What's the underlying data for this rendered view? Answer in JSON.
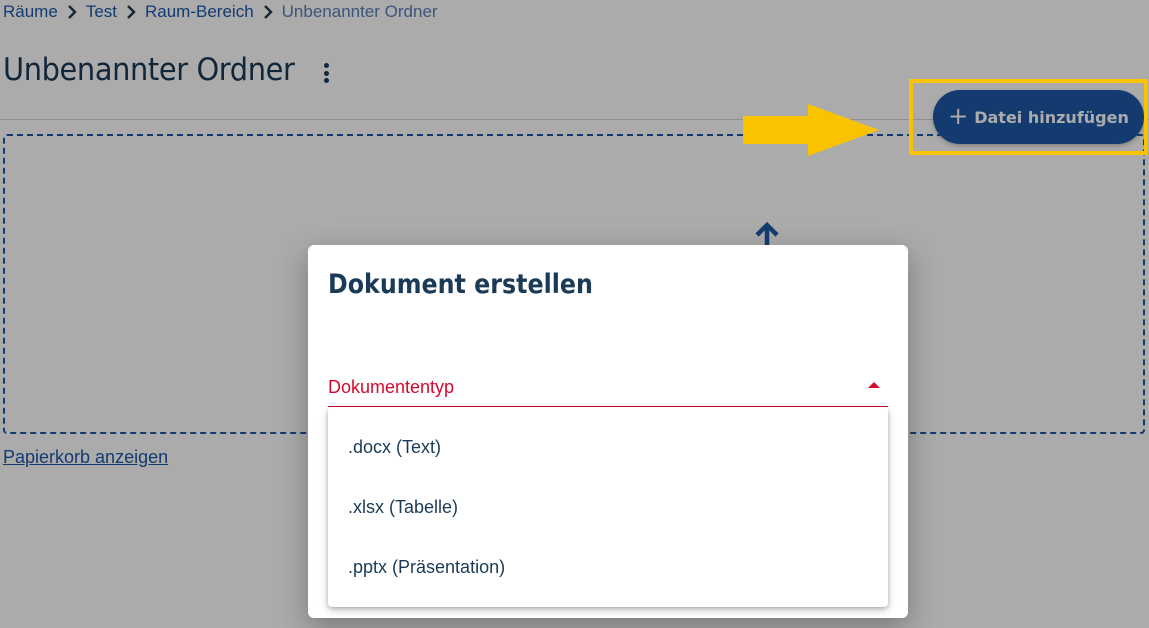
{
  "breadcrumb": {
    "items": [
      "Räume",
      "Test",
      "Raum-Bereich",
      "Unbenannter Ordner"
    ]
  },
  "page": {
    "title": "Unbenannter Ordner"
  },
  "toolbar": {
    "add_file_label": "Datei hinzufügen",
    "add_file_icon": "plus-icon"
  },
  "dropzone": {
    "icon": "upload-arrow-icon"
  },
  "trash_link": "Papierkorb anzeigen",
  "annotation": {
    "highlight_color": "#f9c300",
    "arrow_color": "#f9c300"
  },
  "dialog": {
    "title": "Dokument erstellen",
    "select_label": "Dokumententyp",
    "options": [
      ".docx (Text)",
      ".xlsx (Tabelle)",
      ".pptx (Präsentation)"
    ]
  },
  "colors": {
    "primary": "#1d59a8",
    "heading": "#1b3a57",
    "error": "#d60a2e"
  }
}
